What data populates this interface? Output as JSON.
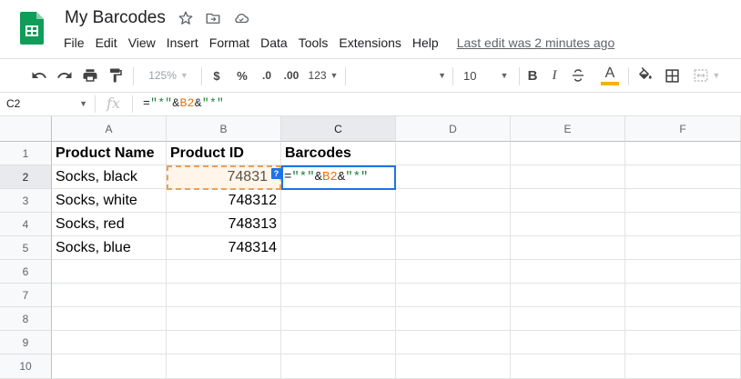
{
  "app": {
    "doc_title": "My Barcodes",
    "brand_color": "#0f9d58"
  },
  "menu": {
    "items": [
      "File",
      "Edit",
      "View",
      "Insert",
      "Format",
      "Data",
      "Tools",
      "Extensions",
      "Help"
    ],
    "last_edit": "Last edit was 2 minutes ago"
  },
  "toolbar": {
    "zoom": "125%",
    "currency": "$",
    "percent": "%",
    "decimal_decrease": ".0",
    "decimal_increase": ".00",
    "more_formats": "123",
    "font_family": "",
    "font_size": "10",
    "bold": "B",
    "italic": "I",
    "text_color_label": "A",
    "text_color_accent": "#f4b400"
  },
  "formula_bar": {
    "name_box": "C2",
    "fx": "fx",
    "formula_parts": [
      "=",
      "\"*\"",
      "&",
      "B2",
      "&",
      "\"*\""
    ]
  },
  "sheet": {
    "columns": [
      "A",
      "B",
      "C",
      "D",
      "E",
      "F"
    ],
    "rows": [
      "1",
      "2",
      "3",
      "4",
      "5",
      "6",
      "7",
      "8",
      "9",
      "10"
    ],
    "headers": [
      "Product Name",
      "Product ID",
      "Barcodes"
    ],
    "data": [
      [
        "Socks, black",
        "748311"
      ],
      [
        "Socks, white",
        "748312"
      ],
      [
        "Socks, red",
        "748313"
      ],
      [
        "Socks, blue",
        "748314"
      ]
    ],
    "visible_b2": "74831",
    "active_cell_ref": "C2",
    "help_badge": "?"
  }
}
